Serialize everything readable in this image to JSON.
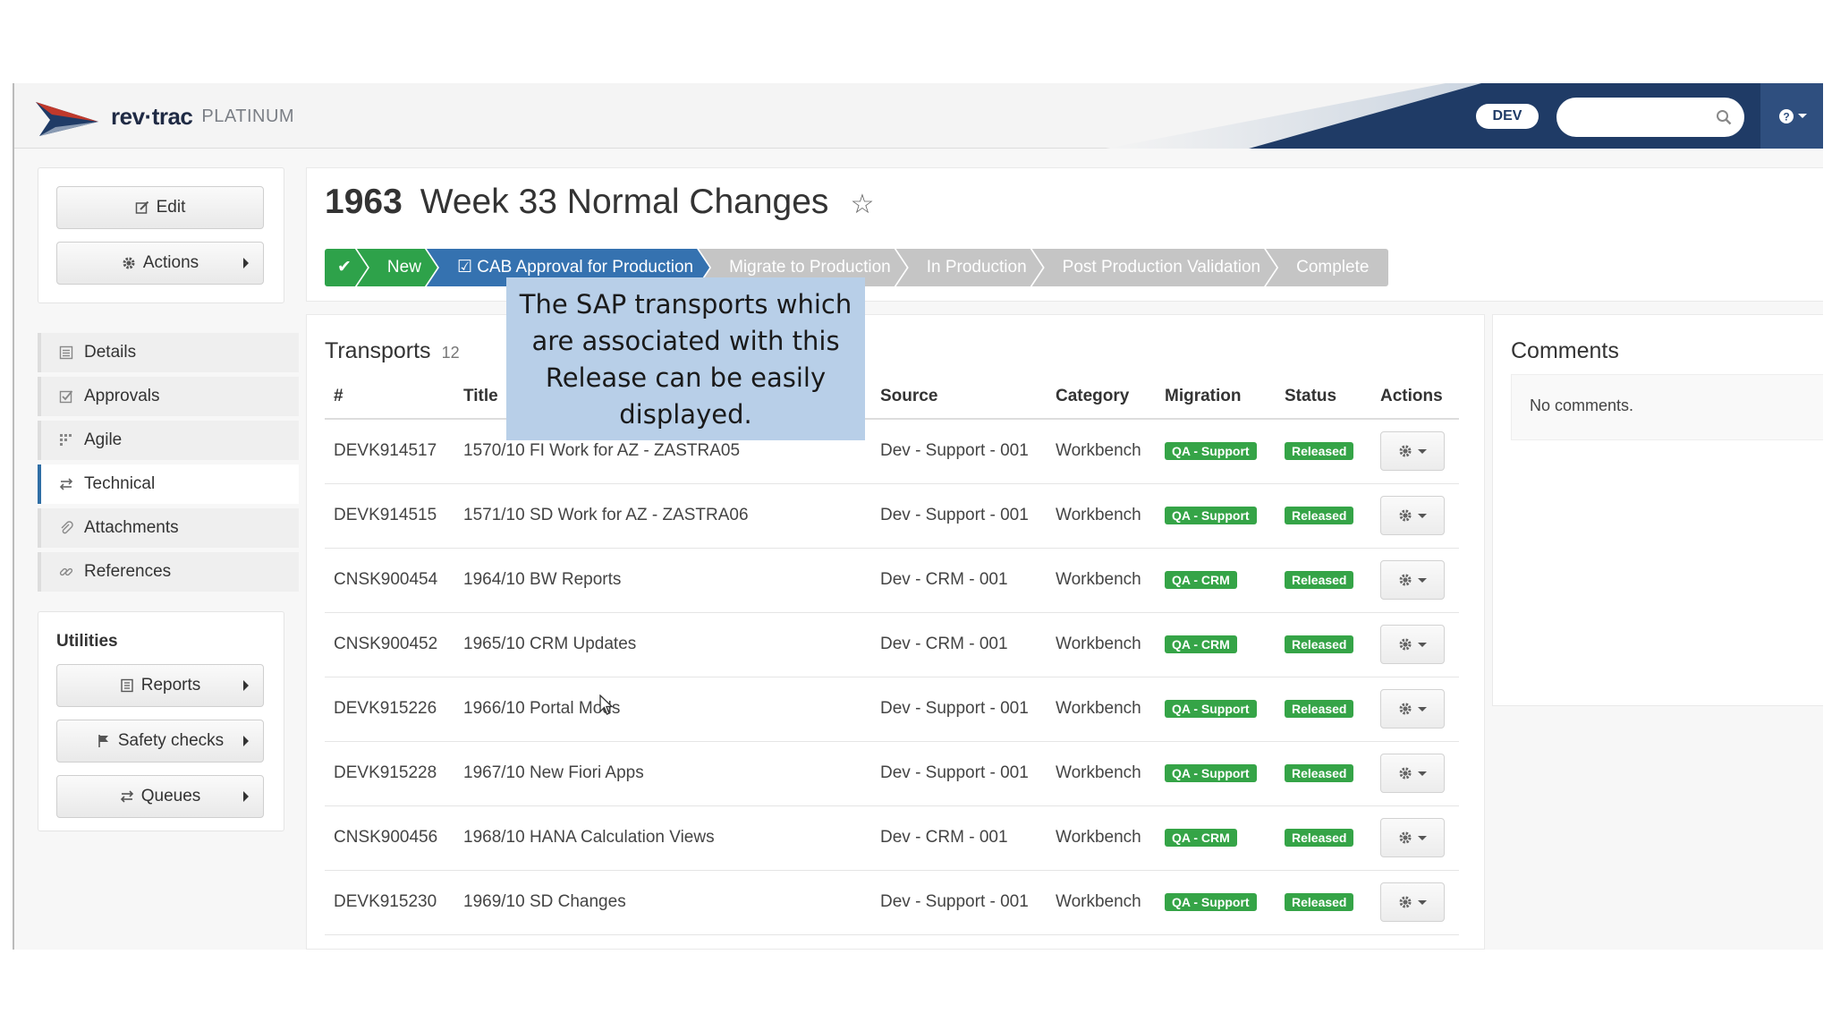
{
  "header": {
    "logo_text": "rev·trac",
    "logo_sub": "PLATINUM",
    "environment": "DEV",
    "search_placeholder": "",
    "colors": {
      "banner_dark": "#1f3b66",
      "help_bg": "#2f4f7f"
    }
  },
  "left": {
    "edit_label": "Edit",
    "actions_label": "Actions",
    "nav": [
      {
        "label": "Details",
        "icon": "list-icon"
      },
      {
        "label": "Approvals",
        "icon": "check-square-icon"
      },
      {
        "label": "Agile",
        "icon": "agile-grid-icon"
      },
      {
        "label": "Technical",
        "icon": "exchange-icon",
        "active": true
      },
      {
        "label": "Attachments",
        "icon": "paperclip-icon"
      },
      {
        "label": "References",
        "icon": "link-icon"
      }
    ],
    "utilities": {
      "title": "Utilities",
      "reports_label": "Reports",
      "safety_label": "Safety checks",
      "queues_label": "Queues"
    }
  },
  "release": {
    "number": "1963",
    "name": "Week 33 Normal Changes",
    "steps": [
      {
        "label": "✔",
        "state": "done"
      },
      {
        "label": "New",
        "state": "done"
      },
      {
        "label": "CAB Approval for Production",
        "state": "current"
      },
      {
        "label": "Migrate to Production",
        "state": "todo"
      },
      {
        "label": "In Production",
        "state": "todo"
      },
      {
        "label": "Post Production Validation",
        "state": "todo"
      },
      {
        "label": "Complete",
        "state": "todo"
      }
    ]
  },
  "transports": {
    "title": "Transports",
    "count": "12",
    "columns": [
      "#",
      "Title",
      "Source",
      "Category",
      "Migration",
      "Status",
      "Actions"
    ],
    "rows": [
      {
        "id": "DEVK914517",
        "title": "1570/10 FI Work for AZ - ZASTRA05",
        "source": "Dev - Support - 001",
        "category": "Workbench",
        "migration": "QA - Support",
        "status": "Released"
      },
      {
        "id": "DEVK914515",
        "title": "1571/10 SD Work for AZ - ZASTRA06",
        "source": "Dev - Support - 001",
        "category": "Workbench",
        "migration": "QA - Support",
        "status": "Released"
      },
      {
        "id": "CNSK900454",
        "title": "1964/10 BW Reports",
        "source": "Dev - CRM - 001",
        "category": "Workbench",
        "migration": "QA - CRM",
        "status": "Released"
      },
      {
        "id": "CNSK900452",
        "title": "1965/10 CRM Updates",
        "source": "Dev - CRM - 001",
        "category": "Workbench",
        "migration": "QA - CRM",
        "status": "Released"
      },
      {
        "id": "DEVK915226",
        "title": "1966/10 Portal Mods",
        "source": "Dev - Support - 001",
        "category": "Workbench",
        "migration": "QA - Support",
        "status": "Released"
      },
      {
        "id": "DEVK915228",
        "title": "1967/10 New Fiori Apps",
        "source": "Dev - Support - 001",
        "category": "Workbench",
        "migration": "QA - Support",
        "status": "Released"
      },
      {
        "id": "CNSK900456",
        "title": "1968/10 HANA Calculation Views",
        "source": "Dev - CRM - 001",
        "category": "Workbench",
        "migration": "QA - CRM",
        "status": "Released"
      },
      {
        "id": "DEVK915230",
        "title": "1969/10 SD Changes",
        "source": "Dev - Support - 001",
        "category": "Workbench",
        "migration": "QA - Support",
        "status": "Released"
      }
    ]
  },
  "comments": {
    "title": "Comments",
    "empty_text": "No comments."
  },
  "callout": {
    "lines": [
      "The SAP transports which",
      "are associated with this",
      "Release can be easily",
      "displayed."
    ]
  }
}
